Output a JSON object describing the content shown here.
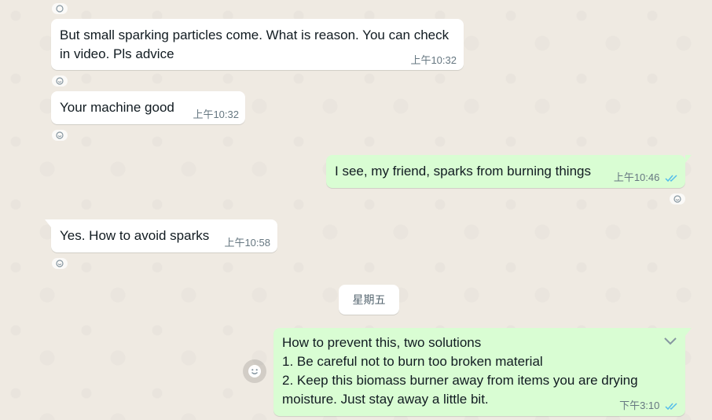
{
  "messages": [
    {
      "text": "But small sparking particles come. What is reason. You can check\nin video. Pls advice",
      "time": "上午10:32",
      "direction": "incoming"
    },
    {
      "text": "Your machine good",
      "time": "上午10:32",
      "direction": "incoming"
    },
    {
      "text": "I see, my friend, sparks from burning things",
      "time": "上午10:46",
      "direction": "outgoing",
      "status": "read"
    },
    {
      "text": "Yes. How to avoid sparks",
      "time": "上午10:58",
      "direction": "incoming"
    },
    {
      "text": "How to prevent this, two solutions\n1. Be careful not to burn too broken material\n2. Keep this biomass burner away from items you are drying\nmoisture. Just stay away a little bit.",
      "time": "下午3:10",
      "direction": "outgoing",
      "status": "read"
    }
  ],
  "date_divider": "星期五",
  "icons": {
    "react": "add-reaction-icon",
    "read": "double-check-icon",
    "menu": "chevron-down-icon",
    "emoji": "emoji-icon"
  },
  "colors": {
    "background": "#efeae2",
    "incoming_bubble": "#ffffff",
    "outgoing_bubble": "#d9fdd3",
    "read_ticks": "#53bdeb",
    "timestamp": "#667781"
  }
}
